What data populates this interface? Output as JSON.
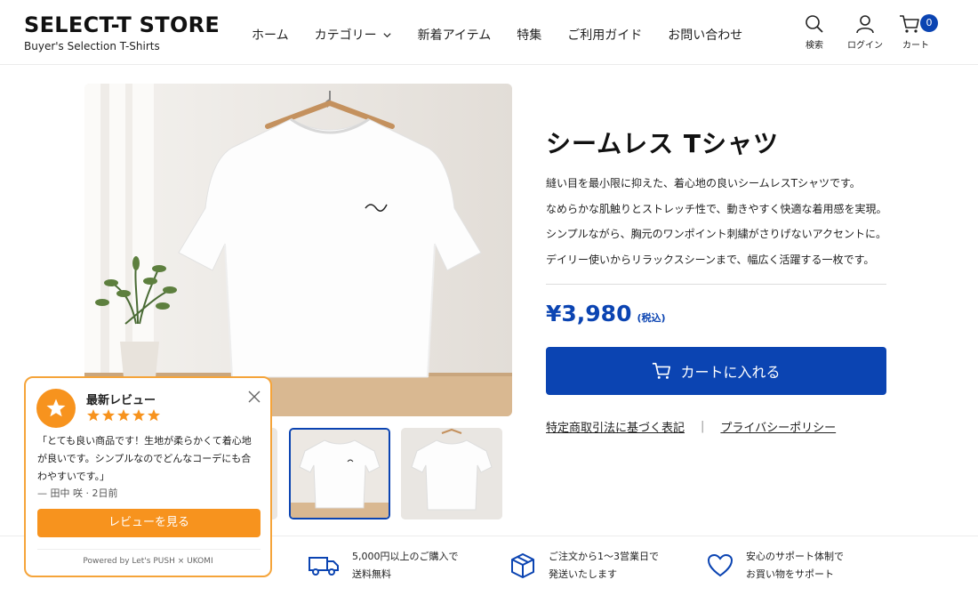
{
  "header": {
    "brand_title": "SELECT-T STORE",
    "brand_sub": "Buyer's Selection T-Shirts",
    "nav": [
      "ホーム",
      "カテゴリー",
      "新着アイテム",
      "特集",
      "ご利用ガイド",
      "お問い合わせ"
    ],
    "icons": {
      "search_label": "検索",
      "login_label": "ログイン",
      "cart_label": "カート",
      "cart_count": "0"
    }
  },
  "product": {
    "title": "シームレス Tシャツ",
    "description": [
      "縫い目を最小限に抑えた、着心地の良いシームレスTシャツです。",
      "なめらかな肌触りとストレッチ性で、動きやすく快適な着用感を実現。",
      "シンプルながら、胸元のワンポイント刺繍がさりげないアクセントに。",
      "デイリー使いからリラックスシーンまで、幅広く活躍する一枚です。"
    ],
    "price": "¥3,980",
    "tax_note": "(税込)",
    "cart_button": "カートに入れる",
    "links": [
      "特定商取引法に基づく表記",
      "プライバシーポリシー"
    ],
    "link_separator": "|"
  },
  "features": [
    {
      "icon": "truck-icon",
      "lines": [
        "5,000円以上のご購入で",
        "送料無料"
      ]
    },
    {
      "icon": "box-icon",
      "lines": [
        "ご注文から1〜3営業日で",
        "発送いたします"
      ]
    },
    {
      "icon": "heart-icon",
      "lines": [
        "安心のサポート体制で",
        "お買い物をサポート"
      ]
    }
  ],
  "review": {
    "title": "最新レビュー",
    "rating": 5,
    "text_lines": [
      "「とても良い商品です！生地が柔らかくて着心地",
      "が良いです。シンプルなのでどんなコーデにも合",
      "わやすいです。」"
    ],
    "author": "— 田中 咲 · 2日前",
    "button": "レビューを見る",
    "powered": "Powered by Let's PUSH × UKOMI"
  },
  "colors": {
    "accent": "#0b44b2",
    "review_accent": "#f7931e",
    "star": "#f7931e"
  }
}
